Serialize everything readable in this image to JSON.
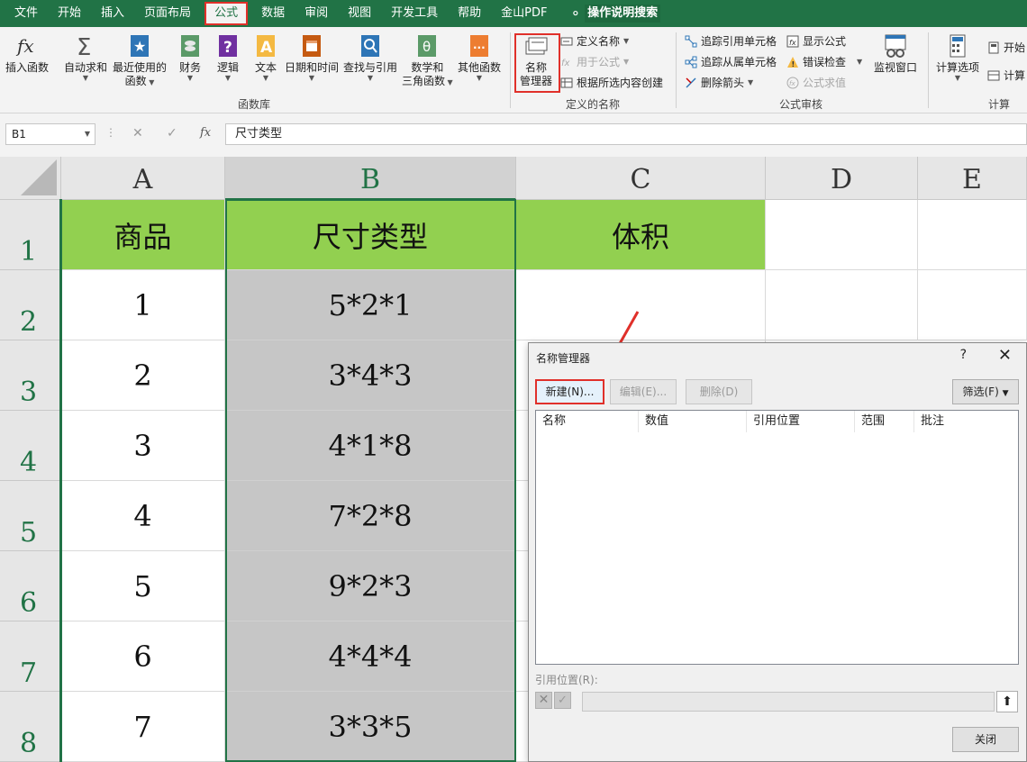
{
  "menu": {
    "tabs": [
      "文件",
      "开始",
      "插入",
      "页面布局",
      "公式",
      "数据",
      "审阅",
      "视图",
      "开发工具",
      "帮助",
      "金山PDF"
    ],
    "active_tab": "公式",
    "search_label": "操作说明搜索"
  },
  "ribbon": {
    "function_library": {
      "label": "函数库",
      "insert_function": "插入函数",
      "autosum": "自动求和",
      "recent_1": "最近使用的",
      "recent_2": "函数",
      "financial": "财务",
      "logical": "逻辑",
      "text": "文本",
      "datetime": "日期和时间",
      "lookup": "查找与引用",
      "math_1": "数学和",
      "math_2": "三角函数",
      "more": "其他函数"
    },
    "defined_names": {
      "label": "定义的名称",
      "name_manager_1": "名称",
      "name_manager_2": "管理器",
      "define_name": "定义名称",
      "use_in_formula": "用于公式",
      "create_from_selection": "根据所选内容创建"
    },
    "formula_auditing": {
      "label": "公式审核",
      "trace_precedents": "追踪引用单元格",
      "trace_dependents": "追踪从属单元格",
      "remove_arrows": "删除箭头",
      "show_formulas": "显示公式",
      "error_checking": "错误检查",
      "evaluate_formula": "公式求值",
      "watch_window": "监视窗口"
    },
    "calculation": {
      "label": "计算",
      "options": "计算选项",
      "start_calc": "开始",
      "calc_sheet": "计算"
    }
  },
  "formula_bar": {
    "name_box": "B1",
    "content": "尺寸类型"
  },
  "grid": {
    "columns": [
      "A",
      "B",
      "C",
      "D",
      "E"
    ],
    "rows": [
      "1",
      "2",
      "3",
      "4",
      "5",
      "6",
      "7",
      "8"
    ],
    "headers": [
      "商品",
      "尺寸类型",
      "体积"
    ],
    "col_a": [
      "1",
      "2",
      "3",
      "4",
      "5",
      "6",
      "7"
    ],
    "col_b": [
      "5*2*1",
      "3*4*3",
      "4*1*8",
      "7*2*8",
      "9*2*3",
      "4*4*4",
      "3*3*5"
    ]
  },
  "dialog": {
    "title": "名称管理器",
    "help": "?",
    "new_button": "新建(N)...",
    "edit_button": "编辑(E)...",
    "delete_button": "删除(D)",
    "filter_button": "筛选(F)",
    "columns": [
      "名称",
      "数值",
      "引用位置",
      "范围",
      "批注"
    ],
    "refers_to_label": "引用位置(R):",
    "close_button": "关闭"
  },
  "colors": {
    "excel_green": "#217346",
    "header_fill": "#92d050",
    "highlight_red": "#e0302a"
  }
}
